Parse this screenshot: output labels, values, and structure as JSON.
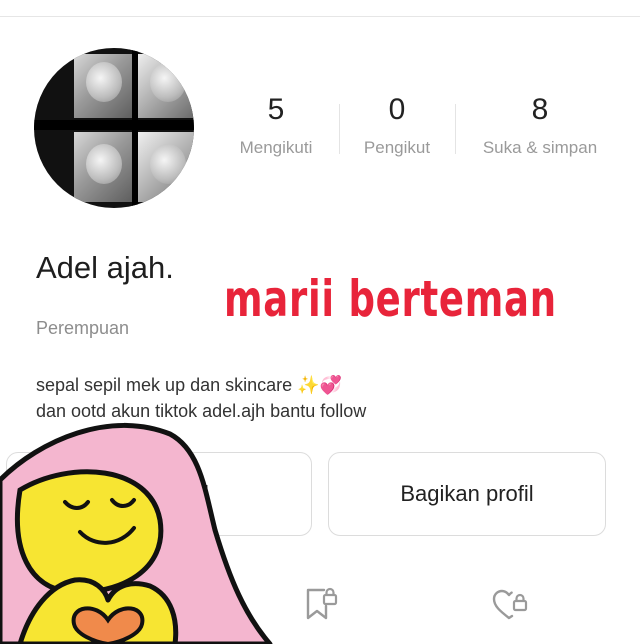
{
  "profile": {
    "name": "Adel ajah.",
    "gender": "Perempuan",
    "bio_line1": "sepal sepil mek up dan skincare",
    "bio_emoji_sparkle": "✨",
    "bio_emoji_hearts": "💞",
    "bio_line2": "dan ootd akun tiktok adel.ajh bantu follow"
  },
  "stats": {
    "following_count": "5",
    "following_label": "Mengikuti",
    "followers_count": "0",
    "followers_label": "Pengikut",
    "likes_count": "8",
    "likes_label": "Suka & simpan"
  },
  "overlay": {
    "text": "marii berteman"
  },
  "buttons": {
    "edit_label": "fil",
    "share_label": "Bagikan profil"
  },
  "icons": {
    "saved": "bookmark-lock-icon",
    "liked": "heart-lock-icon"
  },
  "colors": {
    "overlay_red": "#e8243a",
    "muted_text": "#9a9a9a",
    "sticker_yellow": "#f7e532",
    "sticker_pink": "#f4b6cf",
    "sticker_heart": "#f08a4b"
  }
}
